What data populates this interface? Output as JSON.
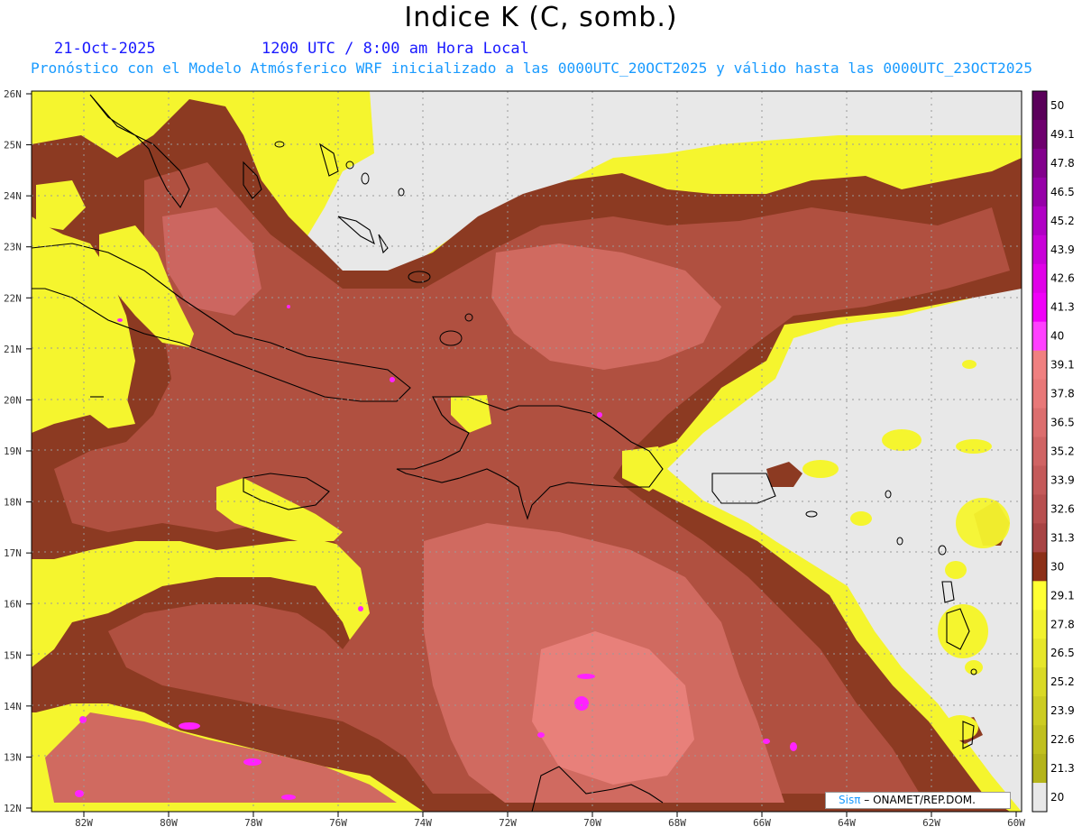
{
  "header": {
    "title": "Indice K (C, somb.)",
    "date": "21-Oct-2025",
    "time": "1200 UTC / 8:00 am Hora Local",
    "subtitle": "Pronóstico con el Modelo Atmósferico WRF inicializado a las 0000UTC_20OCT2025 y válido hasta las  0000UTC_23OCT2025"
  },
  "axes": {
    "lat_labels": [
      "26N",
      "25N",
      "24N",
      "23N",
      "22N",
      "21N",
      "20N",
      "19N",
      "18N",
      "17N",
      "16N",
      "15N",
      "14N",
      "13N",
      "12N"
    ],
    "lon_labels": [
      "82W",
      "80W",
      "78W",
      "76W",
      "74W",
      "72W",
      "70W",
      "68W",
      "66W",
      "64W",
      "62W",
      "60W"
    ]
  },
  "colorbar": {
    "levels": [
      "50",
      "49.1",
      "47.8",
      "46.5",
      "45.2",
      "43.9",
      "42.6",
      "41.3",
      "40",
      "39.1",
      "37.8",
      "36.5",
      "35.2",
      "33.9",
      "32.6",
      "31.3",
      "30",
      "29.1",
      "27.8",
      "26.5",
      "25.2",
      "23.9",
      "22.6",
      "21.3",
      "20"
    ],
    "colors": [
      "#5a005a",
      "#6e006e",
      "#82008c",
      "#9600a8",
      "#b000c4",
      "#c800d8",
      "#e000e8",
      "#f000f8",
      "#ff40ff",
      "#f08080",
      "#e87878",
      "#dc6e6e",
      "#d06464",
      "#c45a5a",
      "#b85050",
      "#a84444",
      "#8c3018",
      "#ffff33",
      "#f2f22e",
      "#e6e62a",
      "#d9d926",
      "#cccc22",
      "#c0c01e",
      "#b4b41a",
      "#e8e8e8"
    ]
  },
  "map_colors": {
    "background": "#e8e8e8",
    "yellow": "#f5f52e",
    "dark_red": "#8c3a22",
    "mid_red": "#b05040",
    "light_red": "#d06a60",
    "pink": "#e8807a",
    "magenta": "#ff22ff",
    "coast": "#000000",
    "grid": "#9a9a9a"
  },
  "credit": {
    "brand": "Sisπ",
    "text": "–  ONAMET/REP.DOM."
  }
}
